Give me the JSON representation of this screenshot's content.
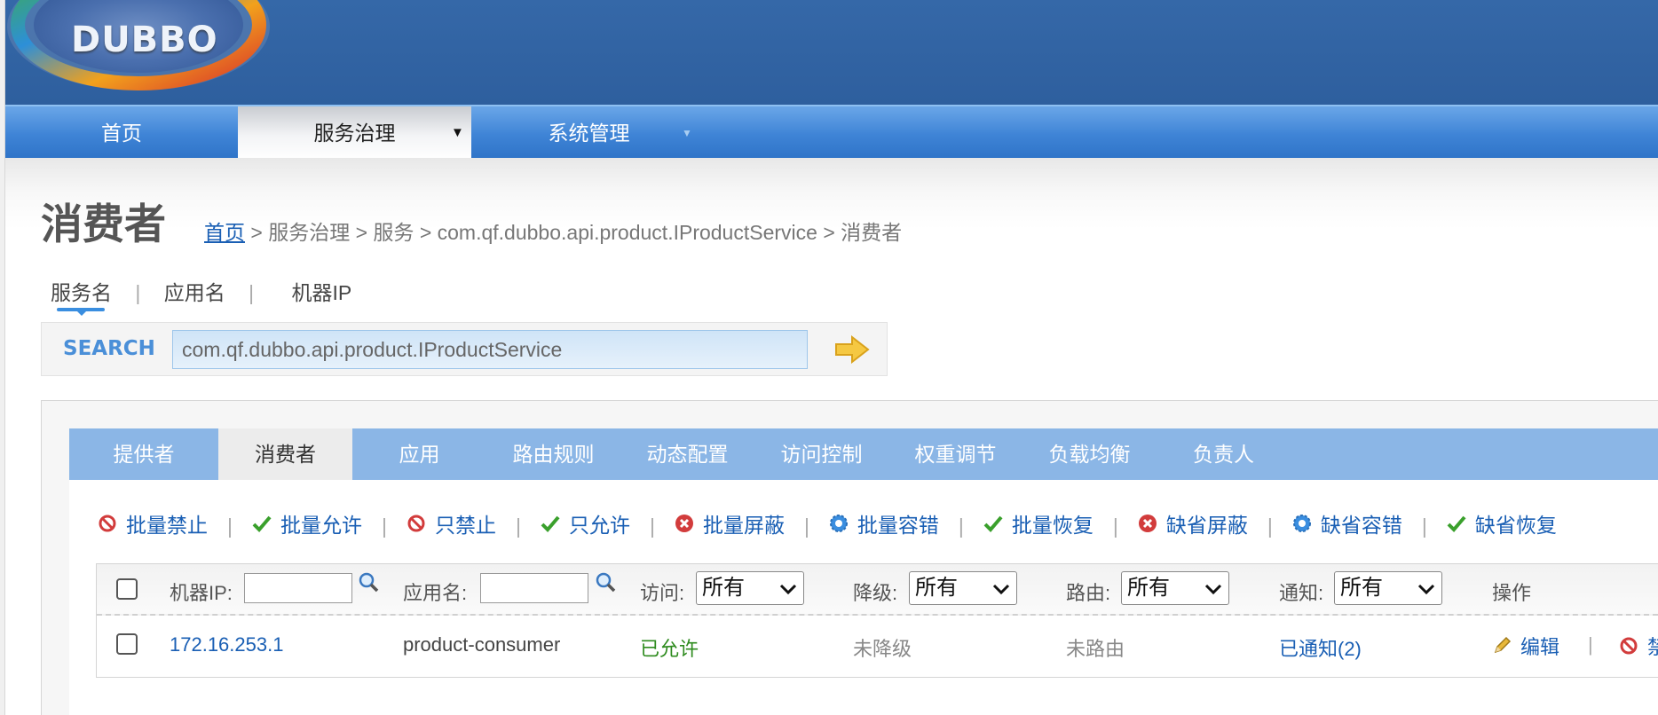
{
  "header": {
    "logo_text": "DUBBO"
  },
  "nav": {
    "items": [
      {
        "label": "首页"
      },
      {
        "label": "服务治理",
        "arrow": "▼"
      },
      {
        "label": "系统管理",
        "arrow": "▼"
      }
    ]
  },
  "page": {
    "title": "消费者",
    "breadcrumb": {
      "home": "首页",
      "rest": " > 服务治理 > 服务 > com.qf.dubbo.api.product.IProductService > 消费者"
    }
  },
  "search": {
    "tabs": [
      "服务名",
      "应用名",
      "机器IP"
    ],
    "separator": "|",
    "label": "SEARCH",
    "value": "com.qf.dubbo.api.product.IProductService"
  },
  "sub_tabs": [
    "提供者",
    "消费者",
    "应用",
    "路由规则",
    "动态配置",
    "访问控制",
    "权重调节",
    "负载均衡",
    "负责人"
  ],
  "actions": [
    {
      "label": "批量禁止",
      "icon": "forbid-icon"
    },
    {
      "label": "批量允许",
      "icon": "check-icon"
    },
    {
      "label": "只禁止",
      "icon": "forbid-icon"
    },
    {
      "label": "只允许",
      "icon": "check-icon"
    },
    {
      "label": "批量屏蔽",
      "icon": "block-icon"
    },
    {
      "label": "批量容错",
      "icon": "gear-icon"
    },
    {
      "label": "批量恢复",
      "icon": "check-icon"
    },
    {
      "label": "缺省屏蔽",
      "icon": "block-icon"
    },
    {
      "label": "缺省容错",
      "icon": "gear-icon"
    },
    {
      "label": "缺省恢复",
      "icon": "check-icon"
    }
  ],
  "action_separator": "|",
  "table": {
    "filters": {
      "ip_label": "机器IP:",
      "app_label": "应用名:",
      "access_label": "访问:",
      "degrade_label": "降级:",
      "route_label": "路由:",
      "notify_label": "通知:",
      "select_value": "所有",
      "ops_label": "操作"
    },
    "rows": [
      {
        "ip": "172.16.253.1",
        "app": "product-consumer",
        "access": "已允许",
        "degrade": "未降级",
        "route": "未路由",
        "notify": "已通知(2)",
        "edit": "编辑",
        "forbid": "禁止"
      }
    ]
  },
  "colors": {
    "header": "#2e5f9e",
    "nav": "#3f84d6",
    "subtab": "#8bb6e6",
    "link": "#1a5fb4",
    "allowed": "#2e8b1e"
  }
}
